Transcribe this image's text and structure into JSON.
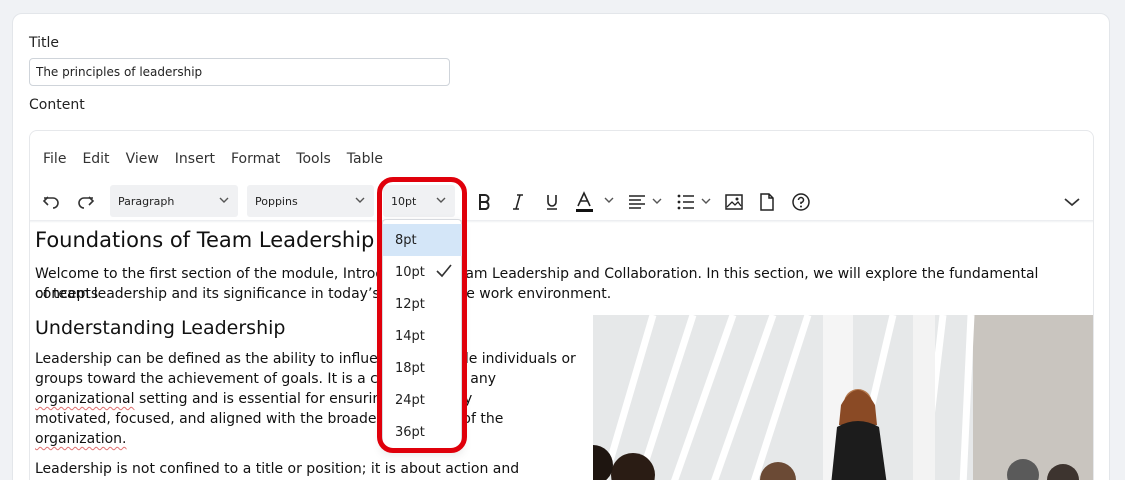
{
  "form": {
    "title_label": "Title",
    "title_value": "The principles of leadership",
    "content_label": "Content"
  },
  "menubar": {
    "items": [
      "File",
      "Edit",
      "View",
      "Insert",
      "Format",
      "Tools",
      "Table"
    ]
  },
  "toolbar": {
    "block_format": "Paragraph",
    "font_family": "Poppins",
    "font_size": "10pt",
    "icons": [
      "undo-icon",
      "redo-icon",
      "bold-icon",
      "italic-icon",
      "underline-icon",
      "text-color-icon",
      "align-icon",
      "bullet-list-icon",
      "image-icon",
      "document-icon",
      "help-icon",
      "more-icon"
    ],
    "text_color": "#111111"
  },
  "document": {
    "h1": "Foundations of Team Leadership",
    "p1_line1": "Welcome to the first section of the module, Introduction to Team Leadership and Collaboration. In this section, we will explore the fundamental concepts",
    "p1_line2": "of team leadership and its significance in today’s collaborative work environment.",
    "h2": "Understanding Leadership",
    "p2_line1": "Leadership can be defined as the ability to influence and guide individuals or",
    "p2_line2": "groups toward the achievement of goals. It is a critical skill in any",
    "p2_line3_a": "organizational",
    "p2_line3_b": " setting and is essential for ensuring teams stay",
    "p2_line4": "motivated, focused, and aligned with the broader objectives of the",
    "p2_line5": "organization.",
    "p3_line1": "Leadership is not confined to a title or position; it is about action and"
  },
  "font_size_dropdown": {
    "options": [
      "8pt",
      "10pt",
      "12pt",
      "14pt",
      "18pt",
      "24pt",
      "36pt"
    ],
    "checked": "10pt",
    "hovered": "8pt"
  },
  "colors": {
    "highlight_ring": "#e0000b",
    "hover_bg": "#d4e6f8"
  }
}
